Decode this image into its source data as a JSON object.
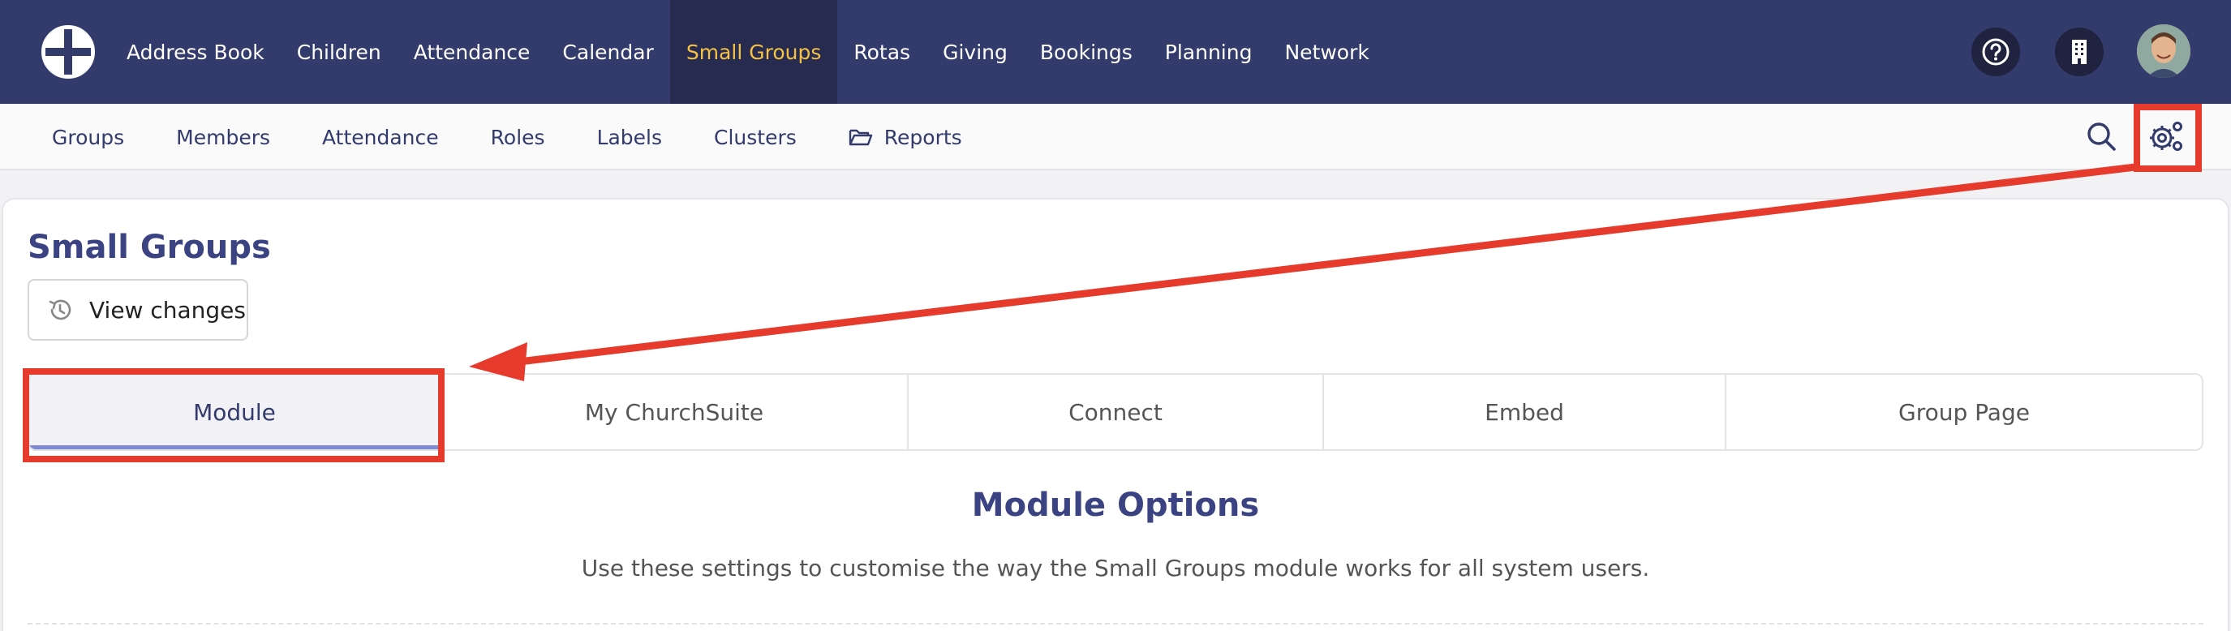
{
  "topnav": {
    "items": [
      {
        "label": "Address Book"
      },
      {
        "label": "Children"
      },
      {
        "label": "Attendance"
      },
      {
        "label": "Calendar"
      },
      {
        "label": "Small Groups",
        "active": true
      },
      {
        "label": "Rotas"
      },
      {
        "label": "Giving"
      },
      {
        "label": "Bookings"
      },
      {
        "label": "Planning"
      },
      {
        "label": "Network"
      }
    ],
    "icons": [
      "help-icon",
      "building-icon"
    ]
  },
  "subnav": {
    "items": [
      {
        "label": "Groups"
      },
      {
        "label": "Members"
      },
      {
        "label": "Attendance"
      },
      {
        "label": "Roles"
      },
      {
        "label": "Labels"
      },
      {
        "label": "Clusters"
      },
      {
        "label": "Reports"
      }
    ]
  },
  "page": {
    "title": "Small Groups",
    "view_changes_label": "View changes"
  },
  "tabs": [
    {
      "label": "Module",
      "active": true
    },
    {
      "label": "My ChurchSuite"
    },
    {
      "label": "Connect"
    },
    {
      "label": "Embed"
    },
    {
      "label": "Group Page"
    }
  ],
  "section": {
    "title": "Module Options",
    "description": "Use these settings to customise the way the Small Groups module works for all system users."
  },
  "colors": {
    "nav_bg": "#323b6b",
    "nav_active_bg": "#262b4f",
    "nav_active_text": "#f5c243",
    "annotation_red": "#e63a2c",
    "accent": "#3b4383"
  }
}
